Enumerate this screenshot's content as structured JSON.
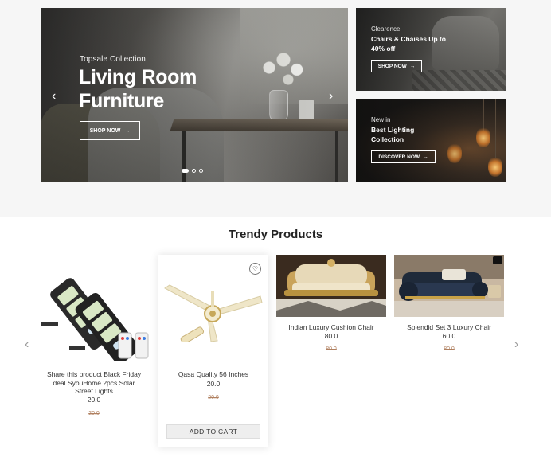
{
  "slider": {
    "subtitle": "Topsale Collection",
    "title": "Living Room Furniture",
    "button_label": "SHOP NOW",
    "button_icon": "arrow-right-icon",
    "prev_icon": "chevron-left-icon",
    "next_icon": "chevron-right-icon",
    "dots_count": 3,
    "active_dot": 1
  },
  "banners": [
    {
      "kicker": "Clearence",
      "title": "Chairs & Chaises Up to 40% off",
      "button_label": "SHOP NOW"
    },
    {
      "kicker": "New in",
      "title": "Best Lighting Collection",
      "button_label": "DISCOVER NOW"
    }
  ],
  "trendy": {
    "title": "Trendy Products",
    "products": [
      {
        "name": "Share this product Black Friday deal SyouHome 2pcs Solar Street Lights",
        "price": "20.0",
        "old_price": "20.0"
      },
      {
        "name": "Qasa Quality 56 Inches",
        "price": "20.0",
        "old_price": "20.0",
        "add_to_cart": "ADD TO CART",
        "wishlist_icon": "heart-icon"
      },
      {
        "name": "Indian Luxury Cushion Chair",
        "price": "80.0",
        "old_price": "80.0"
      },
      {
        "name": "Splendid Set 3 Luxury Chair",
        "price": "60.0",
        "old_price": "80.0"
      }
    ]
  },
  "colors": {
    "accent": "#222222",
    "old_price": "#b08060",
    "hero_background": "#f6f6f6"
  }
}
